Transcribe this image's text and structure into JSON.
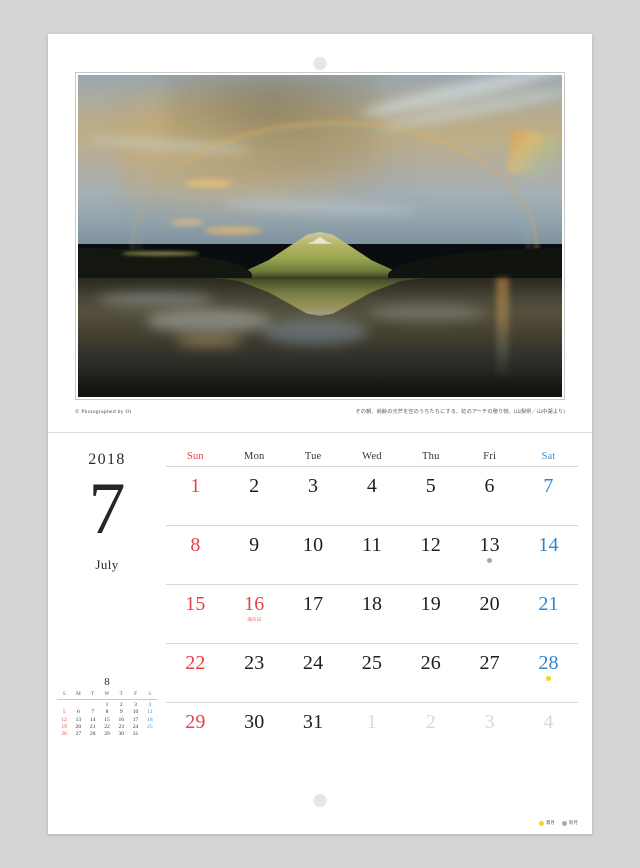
{
  "calendar": {
    "year": "2018",
    "month_number": "7",
    "month_name": "July",
    "photo": {
      "credit": "© Photographed by Oi",
      "caption": "その朝、斜齢の光芒を空のうちたちにする、虹のアーチの贈り物。(山梨県／山中湖より)",
      "scene_description": "Mount Fuji at sunrise with a rainbow arch reflected in a calm lake"
    },
    "weekday_headers": [
      {
        "label": "Sun",
        "type": "sun"
      },
      {
        "label": "Mon",
        "type": "weekday"
      },
      {
        "label": "Tue",
        "type": "weekday"
      },
      {
        "label": "Wed",
        "type": "weekday"
      },
      {
        "label": "Thu",
        "type": "weekday"
      },
      {
        "label": "Fri",
        "type": "weekday"
      },
      {
        "label": "Sat",
        "type": "sat"
      }
    ],
    "weeks": [
      [
        {
          "day": "1",
          "type": "sun"
        },
        {
          "day": "2",
          "type": "weekday"
        },
        {
          "day": "3",
          "type": "weekday"
        },
        {
          "day": "4",
          "type": "weekday"
        },
        {
          "day": "5",
          "type": "weekday"
        },
        {
          "day": "6",
          "type": "weekday"
        },
        {
          "day": "7",
          "type": "sat"
        }
      ],
      [
        {
          "day": "8",
          "type": "sun"
        },
        {
          "day": "9",
          "type": "weekday"
        },
        {
          "day": "10",
          "type": "weekday"
        },
        {
          "day": "11",
          "type": "weekday"
        },
        {
          "day": "12",
          "type": "weekday"
        },
        {
          "day": "13",
          "type": "weekday",
          "moon": "new"
        },
        {
          "day": "14",
          "type": "sat"
        }
      ],
      [
        {
          "day": "15",
          "type": "sun"
        },
        {
          "day": "16",
          "type": "holiday",
          "holiday_label": "海の日"
        },
        {
          "day": "17",
          "type": "weekday"
        },
        {
          "day": "18",
          "type": "weekday"
        },
        {
          "day": "19",
          "type": "weekday"
        },
        {
          "day": "20",
          "type": "weekday"
        },
        {
          "day": "21",
          "type": "sat"
        }
      ],
      [
        {
          "day": "22",
          "type": "sun"
        },
        {
          "day": "23",
          "type": "weekday"
        },
        {
          "day": "24",
          "type": "weekday"
        },
        {
          "day": "25",
          "type": "weekday"
        },
        {
          "day": "26",
          "type": "weekday"
        },
        {
          "day": "27",
          "type": "weekday"
        },
        {
          "day": "28",
          "type": "sat",
          "moon": "full"
        }
      ],
      [
        {
          "day": "29",
          "type": "sun"
        },
        {
          "day": "30",
          "type": "weekday"
        },
        {
          "day": "31",
          "type": "weekday"
        },
        {
          "day": "1",
          "type": "other"
        },
        {
          "day": "2",
          "type": "other"
        },
        {
          "day": "3",
          "type": "other"
        },
        {
          "day": "4",
          "type": "other"
        }
      ]
    ],
    "mini_calendar": {
      "title": "8",
      "headers": [
        {
          "label": "S",
          "type": "sun"
        },
        {
          "label": "M",
          "type": "weekday"
        },
        {
          "label": "T",
          "type": "weekday"
        },
        {
          "label": "W",
          "type": "weekday"
        },
        {
          "label": "T",
          "type": "weekday"
        },
        {
          "label": "F",
          "type": "weekday"
        },
        {
          "label": "S",
          "type": "sat"
        }
      ],
      "weeks": [
        [
          {
            "day": "",
            "type": "empty"
          },
          {
            "day": "",
            "type": "empty"
          },
          {
            "day": "",
            "type": "empty"
          },
          {
            "day": "1",
            "type": "weekday"
          },
          {
            "day": "2",
            "type": "weekday"
          },
          {
            "day": "3",
            "type": "weekday"
          },
          {
            "day": "4",
            "type": "sat"
          }
        ],
        [
          {
            "day": "5",
            "type": "sun"
          },
          {
            "day": "6",
            "type": "weekday"
          },
          {
            "day": "7",
            "type": "weekday"
          },
          {
            "day": "8",
            "type": "weekday"
          },
          {
            "day": "9",
            "type": "weekday"
          },
          {
            "day": "10",
            "type": "weekday"
          },
          {
            "day": "11",
            "type": "sat"
          }
        ],
        [
          {
            "day": "12",
            "type": "sun"
          },
          {
            "day": "13",
            "type": "weekday"
          },
          {
            "day": "14",
            "type": "weekday"
          },
          {
            "day": "15",
            "type": "weekday"
          },
          {
            "day": "16",
            "type": "weekday"
          },
          {
            "day": "17",
            "type": "weekday"
          },
          {
            "day": "18",
            "type": "sat"
          }
        ],
        [
          {
            "day": "19",
            "type": "sun"
          },
          {
            "day": "20",
            "type": "weekday"
          },
          {
            "day": "21",
            "type": "weekday"
          },
          {
            "day": "22",
            "type": "weekday"
          },
          {
            "day": "23",
            "type": "weekday"
          },
          {
            "day": "24",
            "type": "weekday"
          },
          {
            "day": "25",
            "type": "sat"
          }
        ],
        [
          {
            "day": "26",
            "type": "sun"
          },
          {
            "day": "27",
            "type": "weekday"
          },
          {
            "day": "28",
            "type": "weekday"
          },
          {
            "day": "29",
            "type": "weekday"
          },
          {
            "day": "30",
            "type": "weekday"
          },
          {
            "day": "31",
            "type": "weekday"
          },
          {
            "day": "",
            "type": "empty"
          }
        ]
      ]
    },
    "legend": [
      {
        "label": "満月",
        "marker": "full"
      },
      {
        "label": "新月",
        "marker": "new"
      }
    ],
    "colors": {
      "sunday": "#e8424a",
      "saturday": "#3d8fd4",
      "full_moon": "#f2d31a",
      "new_moon": "#a8a8a8",
      "other_month": "#d8d8d8"
    }
  }
}
